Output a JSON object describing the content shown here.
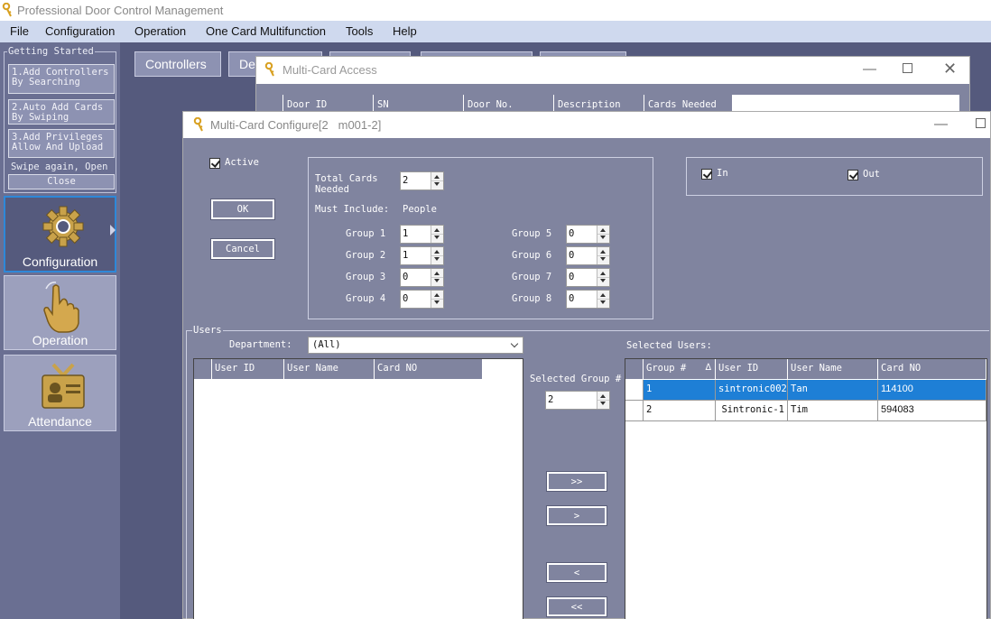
{
  "app": {
    "title": "Professional Door Control Management"
  },
  "menu": [
    "File",
    "Configuration",
    "Operation",
    "One Card Multifunction",
    "Tools",
    "Help"
  ],
  "getting_started": {
    "legend": "Getting Started",
    "items": [
      "1.Add Controllers\nBy Searching",
      "2.Auto Add Cards\nBy Swiping",
      "3.Add Privileges\nAllow And Upload"
    ],
    "swipe_text": "Swipe again, Open",
    "close_label": "Close"
  },
  "nav": [
    {
      "label": "Configuration",
      "icon": "gear-icon",
      "selected": true
    },
    {
      "label": "Operation",
      "icon": "hand-pointer-icon",
      "selected": false
    },
    {
      "label": "Attendance",
      "icon": "id-badge-icon",
      "selected": false
    }
  ],
  "tabs": {
    "controllers": "Controllers",
    "second": "De"
  },
  "multi_card_access": {
    "title": "Multi-Card Access",
    "columns": [
      "Door ID",
      "SN",
      "Door No.",
      "Description",
      "Cards Needed"
    ]
  },
  "configure": {
    "title": "Multi-Card Configure[2   m001-2]",
    "active_label": "Active",
    "ok_label": "OK",
    "cancel_label": "Cancel",
    "total_cards_label": "Total Cards\nNeeded",
    "total_cards_value": "2",
    "must_include_label": "Must Include:",
    "people_label": "People",
    "groups": [
      {
        "label": "Group 1",
        "value": "1"
      },
      {
        "label": "Group 2",
        "value": "1"
      },
      {
        "label": "Group 3",
        "value": "0"
      },
      {
        "label": "Group 4",
        "value": "0"
      },
      {
        "label": "Group 5",
        "value": "0"
      },
      {
        "label": "Group 6",
        "value": "0"
      },
      {
        "label": "Group 7",
        "value": "0"
      },
      {
        "label": "Group 8",
        "value": "0"
      }
    ],
    "in_label": "In",
    "out_label": "Out",
    "users_legend": "Users",
    "department_label": "Department:",
    "department_value": "(All)",
    "users_columns": [
      "User ID",
      "User Name",
      "Card NO"
    ],
    "selected_group_label": "Selected Group #",
    "selected_group_value": "2",
    "buttons": {
      "add_all": ">>",
      "add": ">",
      "remove": "<",
      "remove_all": "<<"
    },
    "selected_users_label": "Selected Users:",
    "selected_columns": [
      "Group #",
      "User ID",
      "User Name",
      "Card NO"
    ],
    "selected_rows": [
      {
        "group": "1",
        "user_id": "sintronic002",
        "user_name": "Tan",
        "card_no": "114100"
      },
      {
        "group": "2",
        "user_id": "Sintronic-1",
        "user_name": "Tim",
        "card_no": "594083"
      }
    ]
  },
  "colors": {
    "selection": "#1e7fd6",
    "dialog_bg": "#80849f",
    "menu_bg": "#cfd9ee"
  }
}
